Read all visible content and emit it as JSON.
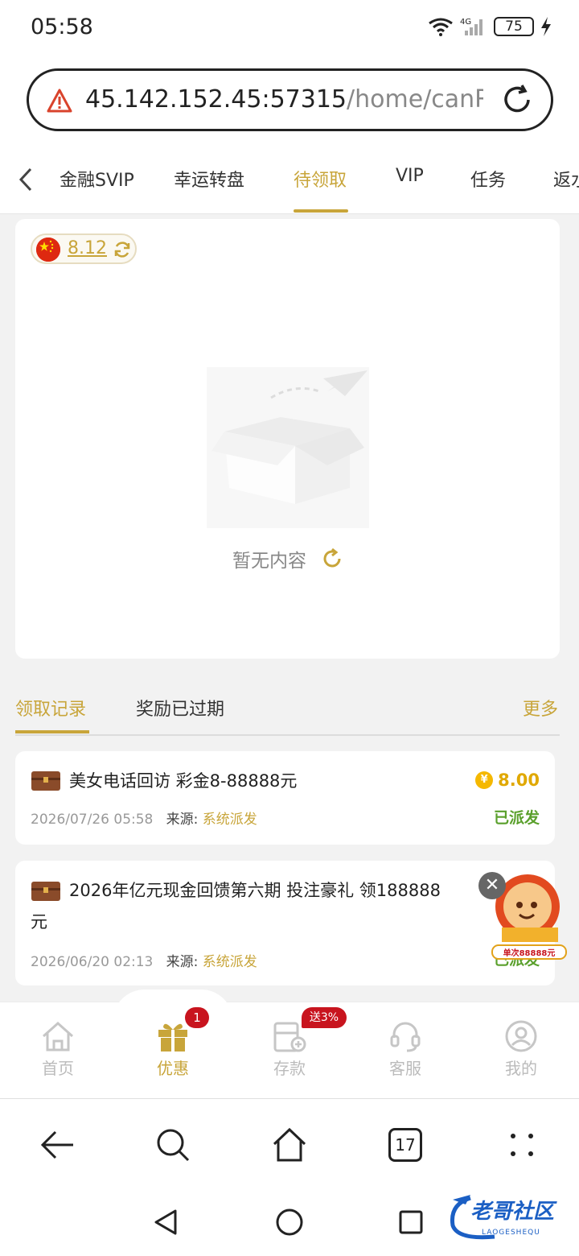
{
  "status_bar": {
    "time": "05:58",
    "battery": "75",
    "network": "4G"
  },
  "url_bar": {
    "host": "45.142.152.45:57315",
    "path": "/home/canRe"
  },
  "tabs": [
    {
      "label": "金融SVIP",
      "shown": "金融SVIP"
    },
    {
      "label": "幸运转盘"
    },
    {
      "label": "待领取"
    },
    {
      "label": "VIP"
    },
    {
      "label": "任务"
    },
    {
      "label": "返水"
    }
  ],
  "card": {
    "balance": "8.12",
    "empty_text": "暂无内容"
  },
  "records": {
    "tabs": [
      "领取记录",
      "奖励已过期"
    ],
    "more": "更多",
    "items": [
      {
        "title": "美女电话回访 彩金8-88888元",
        "time": "2026/07/26 05:58",
        "source_label": "来源:",
        "source": "系统派发",
        "amount": "8.00",
        "status": "已派发"
      },
      {
        "title_line1": "2026年亿元现金回馈第六期 投注豪礼 领188888",
        "title_line2": "元",
        "time": "2026/06/20 02:13",
        "source_label": "来源:",
        "source": "系统派发",
        "status": "已派发"
      }
    ]
  },
  "promo": {
    "label": "单次88888元"
  },
  "app_nav": {
    "items": [
      "首页",
      "优惠",
      "存款",
      "客服",
      "我的"
    ],
    "badge": "1",
    "deposit_badge": "送3%"
  },
  "browser_nav": {
    "tab_count": "17"
  },
  "watermark": {
    "cn": "老哥社区",
    "en": "LAOGESHEQU"
  },
  "colors": {
    "accent": "#c8a53a",
    "status_green": "#5aa02c",
    "badge_red": "#c8141e"
  }
}
